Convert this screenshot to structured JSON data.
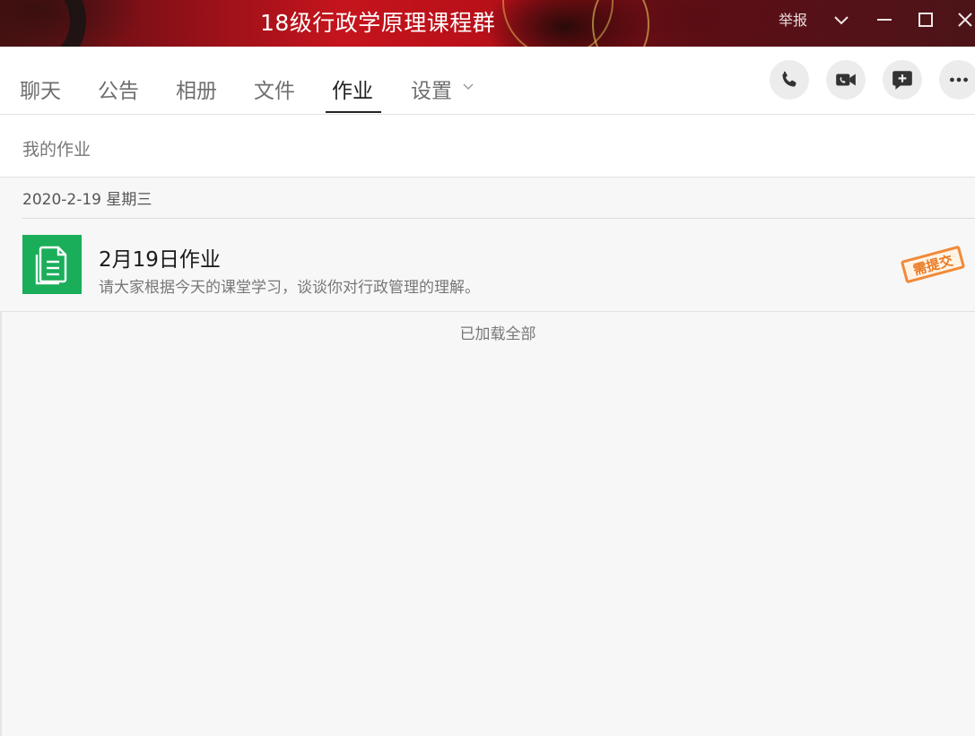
{
  "window": {
    "title": "18级行政学原理课程群",
    "report_label": "举报"
  },
  "tabs": [
    {
      "label": "聊天"
    },
    {
      "label": "公告"
    },
    {
      "label": "相册"
    },
    {
      "label": "文件"
    },
    {
      "label": "作业",
      "active": true
    },
    {
      "label": "设置"
    }
  ],
  "actions": [
    "phone-icon",
    "video-call-icon",
    "add-message-icon",
    "more-icon"
  ],
  "section": {
    "title": "我的作业"
  },
  "homework": {
    "date": "2020-2-19 星期三",
    "items": [
      {
        "title": "2月19日作业",
        "description": "请大家根据今天的课堂学习，谈谈你对行政管理的理解。",
        "stamp": "需提交",
        "icon": "document-icon",
        "icon_color": "#1bae5a"
      }
    ],
    "footer": "已加载全部"
  },
  "colors": {
    "stamp": "#f08a3a",
    "title_bar": "#b81019"
  }
}
